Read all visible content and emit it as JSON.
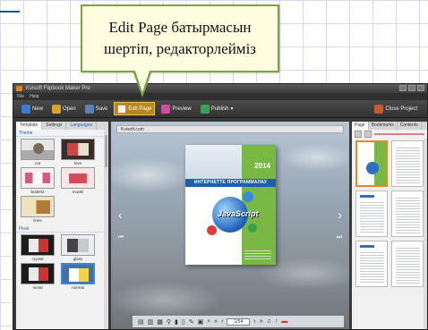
{
  "callout": {
    "line1": "Edit Page батырмасын",
    "line2": "шертіп, редакторлейміз"
  },
  "app": {
    "title": "Kvisoft Flipbook Maker Pro",
    "menu": [
      "File",
      "Help"
    ],
    "toolbar": {
      "new": "New",
      "open": "Open",
      "save": "Save",
      "edit_page": "Edit Page",
      "preview": "Preview",
      "publish": "Publish",
      "close_project": "Close Project"
    },
    "left_panel": {
      "tabs": [
        "Template",
        "Settings",
        "Languages"
      ],
      "section_theme": "Theme",
      "theme_templates": [
        {
          "label": "cat",
          "style": "t-cat"
        },
        {
          "label": "love",
          "style": "t-dark"
        },
        {
          "label": "bride02",
          "style": "t-pink"
        },
        {
          "label": "model",
          "style": "t-red"
        },
        {
          "label": "lines",
          "style": "t-ped"
        }
      ],
      "section_float": "Float",
      "float_templates": [
        {
          "label": "crystal",
          "style": "t-black"
        },
        {
          "label": "glass",
          "style": "t-glass"
        },
        {
          "label": "metal",
          "style": "t-black"
        },
        {
          "label": "normal",
          "style": "t-blue"
        }
      ]
    },
    "canvas": {
      "url": "Kvisoft.com",
      "book_year": "2014",
      "book_banner": "ИНТЕРНЕТТЕ ПРОГРАММАЛАУ",
      "book_logo": "JavaScript",
      "page_box": "1/54",
      "nav_prev": "‹",
      "nav_next": "›",
      "toolbar_icons": [
        "print-icon",
        "thumbnails-icon",
        "grid-icon",
        "zoom-icon",
        "bookmark-icon",
        "highlight-icon",
        "pen-icon",
        "share-icon",
        "search-icon",
        "first-page-icon",
        "prev-page-icon",
        "next-page-icon",
        "last-page-icon",
        "sound-icon",
        "fullscreen-icon",
        "flag-icon"
      ]
    },
    "right_panel": {
      "tabs": [
        "Page",
        "Bookmarks",
        "Contents"
      ]
    }
  }
}
